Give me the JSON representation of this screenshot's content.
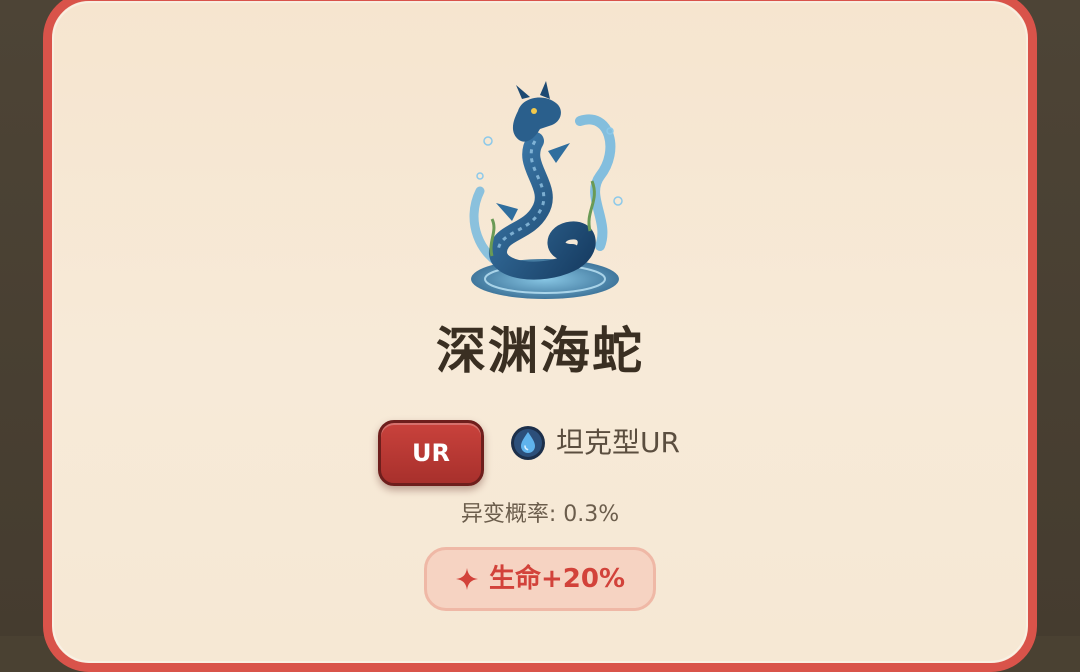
{
  "creature": {
    "name": "深渊海蛇",
    "rarity": "UR",
    "type_label": "坦克型UR",
    "mutation_text": "异变概率: 0.3%",
    "bonus_text": "生命+20%",
    "image_icon": "sea-serpent-illustration",
    "type_icon": "water-drop-icon",
    "bonus_icon": "sparkle-icon"
  },
  "colors": {
    "card_border": "#d9534a",
    "card_bg": "#f6e5cf",
    "rarity_badge": "#b8362f",
    "bonus_text": "#d2423a",
    "bonus_bg": "#f6d3c2"
  }
}
